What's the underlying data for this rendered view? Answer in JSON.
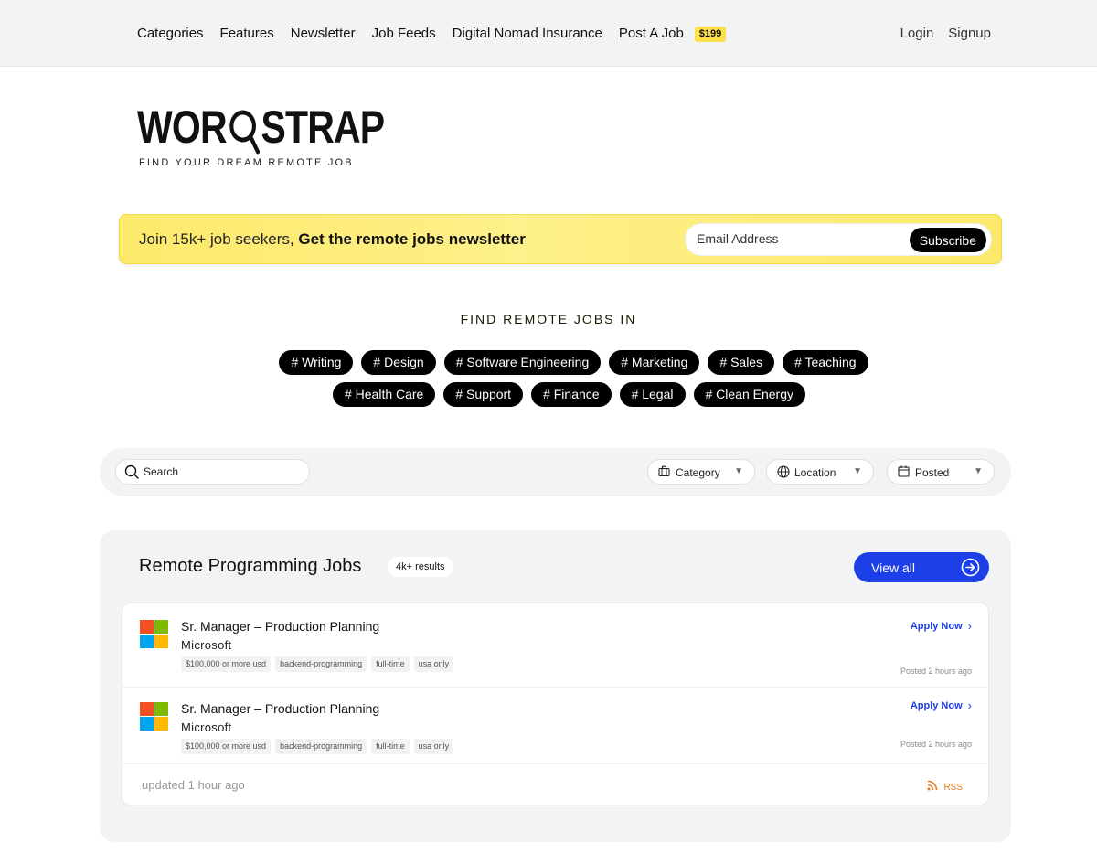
{
  "nav": {
    "items": [
      "Categories",
      "Features",
      "Newsletter",
      "Job Feeds",
      "Digital Nomad Insurance",
      "Post A Job"
    ],
    "post_price": "$199",
    "login": "Login",
    "signup": "Signup"
  },
  "logo": {
    "word_left": "WOR",
    "word_right": "STRAP",
    "tagline": "FIND YOUR DREAM REMOTE JOB"
  },
  "newsletter": {
    "text_prefix": "Join 15k+ job seekers,",
    "text_bold": "Get the remote jobs newsletter",
    "email_placeholder": "Email Address",
    "subscribe_label": "Subscribe"
  },
  "categories": {
    "title": "FIND REMOTE JOBS IN",
    "row1": [
      "# Writing",
      "# Design",
      "# Software Engineering",
      "# Marketing",
      "# Sales",
      "# Teaching"
    ],
    "row2": [
      "# Health Care",
      "# Support",
      "# Finance",
      "# Legal",
      "# Clean Energy"
    ]
  },
  "filters": {
    "search_placeholder": "Search",
    "category": "Category",
    "location": "Location",
    "posted": "Posted"
  },
  "jobs": {
    "title": "Remote Programming Jobs",
    "results": "4k+ results",
    "view_all": "View all",
    "listings": [
      {
        "title": "Sr. Manager – Production Planning",
        "company": "Microsoft",
        "tags": [
          "$100,000 or more usd",
          "backend-programming",
          "full-time",
          "usa only"
        ],
        "apply": "Apply Now",
        "posted": "Posted 2 hours ago"
      },
      {
        "title": "Sr. Manager – Production Planning",
        "company": "Microsoft",
        "tags": [
          "$100,000 or more usd",
          "backend-programming",
          "full-time",
          "usa only"
        ],
        "apply": "Apply Now",
        "posted": "Posted 2 hours ago"
      }
    ],
    "updated": "updated 1 hour ago",
    "rss": "RSS"
  },
  "colors": {
    "accent_blue": "#1d3fe8",
    "newsletter_yellow": "#fde96a",
    "badge_yellow": "#fde047",
    "rss_orange": "#e07b1f"
  }
}
